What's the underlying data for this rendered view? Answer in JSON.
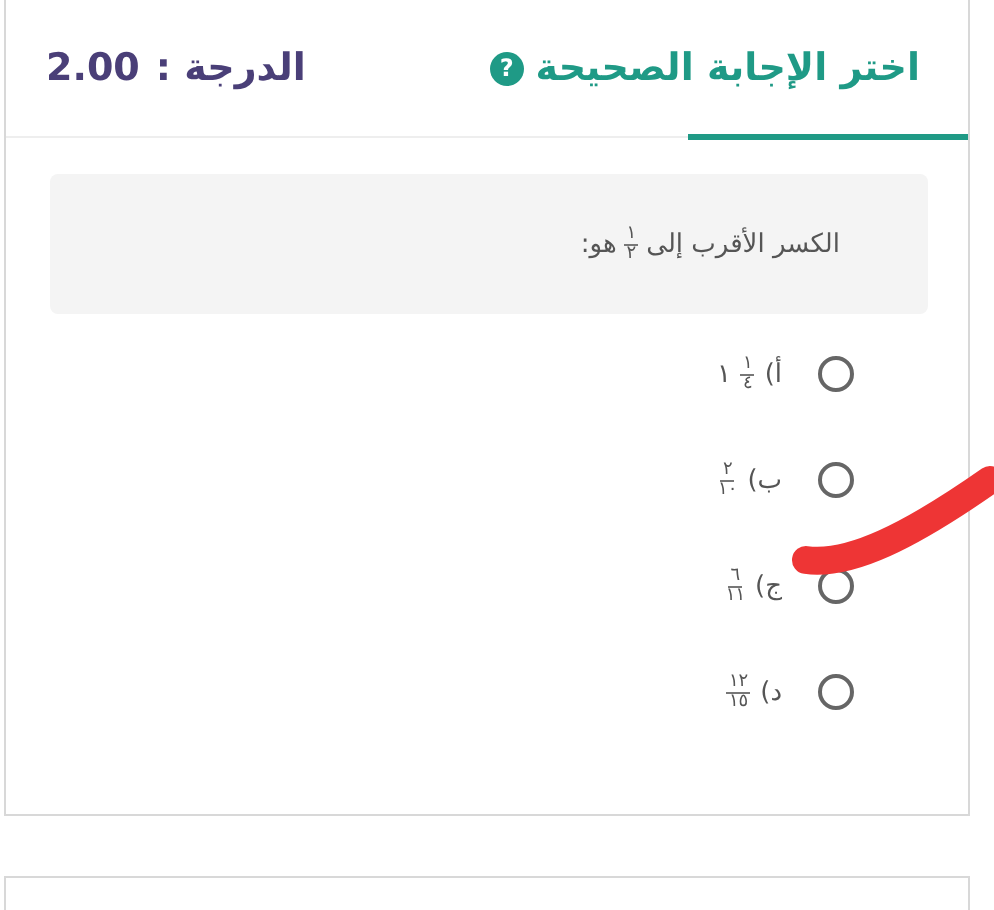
{
  "header": {
    "title": "اختر الإجابة الصحيحة",
    "help_icon": "?",
    "grade_label": "الدرجة :",
    "grade": "2.00"
  },
  "question": {
    "before": "الكسر الأقرب إلى",
    "fraction": {
      "numerator": "١",
      "denominator": "٢"
    },
    "after": "هو:"
  },
  "options": [
    {
      "letter": "أ)",
      "whole": "١",
      "numerator": "١",
      "denominator": "٤",
      "selected": false
    },
    {
      "letter": "ب)",
      "numerator": "٢",
      "denominator": "١٠",
      "selected": false
    },
    {
      "letter": "ج)",
      "numerator": "٦",
      "denominator": "١١",
      "selected": false
    },
    {
      "letter": "د)",
      "numerator": "١٢",
      "denominator": "١٥",
      "selected": false
    }
  ]
}
